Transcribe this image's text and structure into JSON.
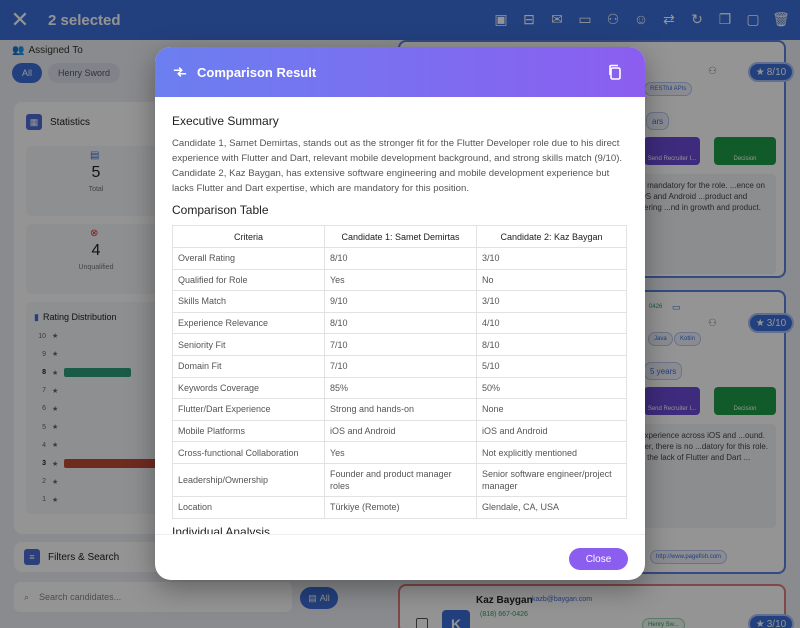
{
  "topbar": {
    "title": "2 selected",
    "actions": [
      "select-all-icon",
      "archive-icon",
      "mail-icon",
      "sms-icon",
      "assign-user-icon",
      "ai-icon",
      "compare-icon",
      "refresh-icon",
      "copy-icon",
      "move-folder-icon",
      "delete-icon"
    ]
  },
  "left": {
    "assigned_label": "Assigned To",
    "chips": [
      "All",
      "Henry Sword"
    ],
    "statistics_label": "Statistics",
    "stats": [
      {
        "value": "5",
        "label": "Total"
      },
      {
        "value": "4",
        "label": "Unqualified"
      }
    ],
    "rating_title": "Rating Distribution",
    "rating_rows": [
      {
        "n": "10",
        "count": 0
      },
      {
        "n": "9",
        "count": 0
      },
      {
        "n": "8",
        "count": 1
      },
      {
        "n": "7",
        "count": 0
      },
      {
        "n": "6",
        "count": 0
      },
      {
        "n": "5",
        "count": 0
      },
      {
        "n": "4",
        "count": 0
      },
      {
        "n": "3",
        "count": 2
      },
      {
        "n": "2",
        "count": 0
      },
      {
        "n": "1",
        "count": 0
      }
    ],
    "filters_label": "Filters & Search",
    "search_placeholder": "Search candidates...",
    "all_button": "All"
  },
  "right": {
    "card1": {
      "rating": "8/10",
      "tag": "RESTful APIs",
      "step_send": "Send Recruiter I...",
      "step_decision": "Decision",
      "years": "ars",
      "desc": "...h are mandatory for the role. ...ence on both iOS and Android ...product and engineering ...nd in growth and product."
    },
    "card2": {
      "rating": "3/10",
      "phone_fragment": "0426",
      "tags": [
        "Java",
        "Kotlin"
      ],
      "years": "5 years",
      "step_send": "Send Recruiter I...",
      "step_decision": "Decision",
      "desc": "...ent experience across iOS and ...ound. However, there is no ...datory for this role. The ...t the lack of Flutter and Dart ...",
      "link": "http://www.pagefish.com"
    },
    "card3": {
      "name": "Kaz Baygan",
      "email": "kazb@baygan.com",
      "phone": "(818) 667-0426",
      "avatar": "K",
      "assignee": "Henry Sw...",
      "rating": "3/10"
    }
  },
  "modal": {
    "title": "Comparison Result",
    "exec_heading": "Executive Summary",
    "exec_text": "Candidate 1, Samet Demirtas, stands out as the stronger fit for the Flutter Developer role due to his direct experience with Flutter and Dart, relevant mobile development background, and strong skills match (9/10). Candidate 2, Kaz Baygan, has extensive software engineering and mobile development experience but lacks Flutter and Dart expertise, which are mandatory for this position.",
    "table_heading": "Comparison Table",
    "columns": [
      "Criteria",
      "Candidate 1: Samet Demirtas",
      "Candidate 2: Kaz Baygan"
    ],
    "rows": [
      [
        "Overall Rating",
        "8/10",
        "3/10"
      ],
      [
        "Qualified for Role",
        "Yes",
        "No"
      ],
      [
        "Skills Match",
        "9/10",
        "3/10"
      ],
      [
        "Experience Relevance",
        "8/10",
        "4/10"
      ],
      [
        "Seniority Fit",
        "7/10",
        "8/10"
      ],
      [
        "Domain Fit",
        "7/10",
        "5/10"
      ],
      [
        "Keywords Coverage",
        "85%",
        "50%"
      ],
      [
        "Flutter/Dart Experience",
        "Strong and hands-on",
        "None"
      ],
      [
        "Mobile Platforms",
        "iOS and Android",
        "iOS and Android"
      ],
      [
        "Cross-functional Collaboration",
        "Yes",
        "Not explicitly mentioned"
      ],
      [
        "Leadership/Ownership",
        "Founder and product manager roles",
        "Senior software engineer/project manager"
      ],
      [
        "Location",
        "Türkiye (Remote)",
        "Glendale, CA, USA"
      ]
    ],
    "individual_heading": "Individual Analysis",
    "close_label": "Close"
  },
  "colors": {
    "topbar": "#3d6fd9",
    "modal_gradient_start": "#6b7ff0",
    "modal_gradient_end": "#8b5ef0",
    "bar_green": "#2e9d7a",
    "bar_red": "#c24a3a"
  }
}
